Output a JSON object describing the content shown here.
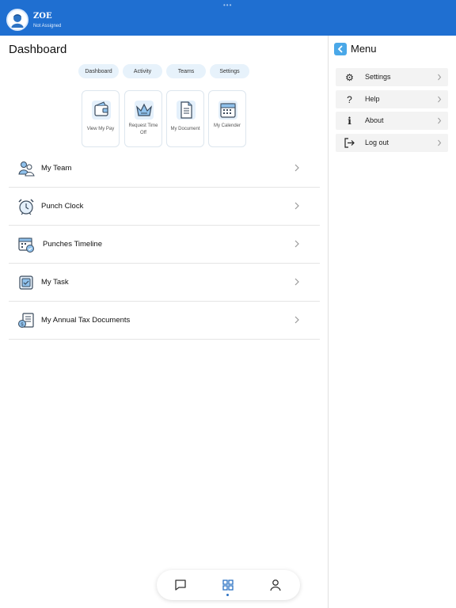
{
  "header": {
    "user_name": "ZOE",
    "user_status": "Not Assigned"
  },
  "dashboard": {
    "title": "Dashboard",
    "pills": [
      {
        "label": "Dashboard"
      },
      {
        "label": "Activity"
      },
      {
        "label": "Teams"
      },
      {
        "label": "Settings"
      }
    ],
    "cards": [
      {
        "label": "View My Pay",
        "icon": "wallet-icon"
      },
      {
        "label": "Request Time Off",
        "icon": "crown-icon"
      },
      {
        "label": "My Document",
        "icon": "document-icon"
      },
      {
        "label": "My Calender",
        "icon": "calendar-icon"
      }
    ],
    "list": [
      {
        "label": "My Team",
        "icon": "team-icon"
      },
      {
        "label": "Punch Clock",
        "icon": "alarm-clock-icon"
      },
      {
        "label": "Punches Timeline",
        "icon": "timeline-calendar-icon"
      },
      {
        "label": "My Task",
        "icon": "task-icon"
      },
      {
        "label": "My Annual Tax Documents",
        "icon": "tax-document-icon"
      }
    ]
  },
  "tabbar": {
    "tabs": [
      {
        "icon": "chat-icon"
      },
      {
        "icon": "grid-icon",
        "active": true
      },
      {
        "icon": "person-icon"
      }
    ]
  },
  "menu": {
    "title": "Menu",
    "items": [
      {
        "label": "Settings",
        "icon": "gear-icon",
        "glyph": "⚙"
      },
      {
        "label": "Help",
        "icon": "question-icon",
        "glyph": "?"
      },
      {
        "label": "About",
        "icon": "info-icon",
        "glyph": "i"
      },
      {
        "label": "Log out",
        "icon": "logout-icon",
        "glyph": ""
      }
    ]
  },
  "colors": {
    "header": "#1f6fd1",
    "accent": "#4aa8e8",
    "pill_bg": "#e7f2fb",
    "menu_item_bg": "#f3f3f3"
  }
}
